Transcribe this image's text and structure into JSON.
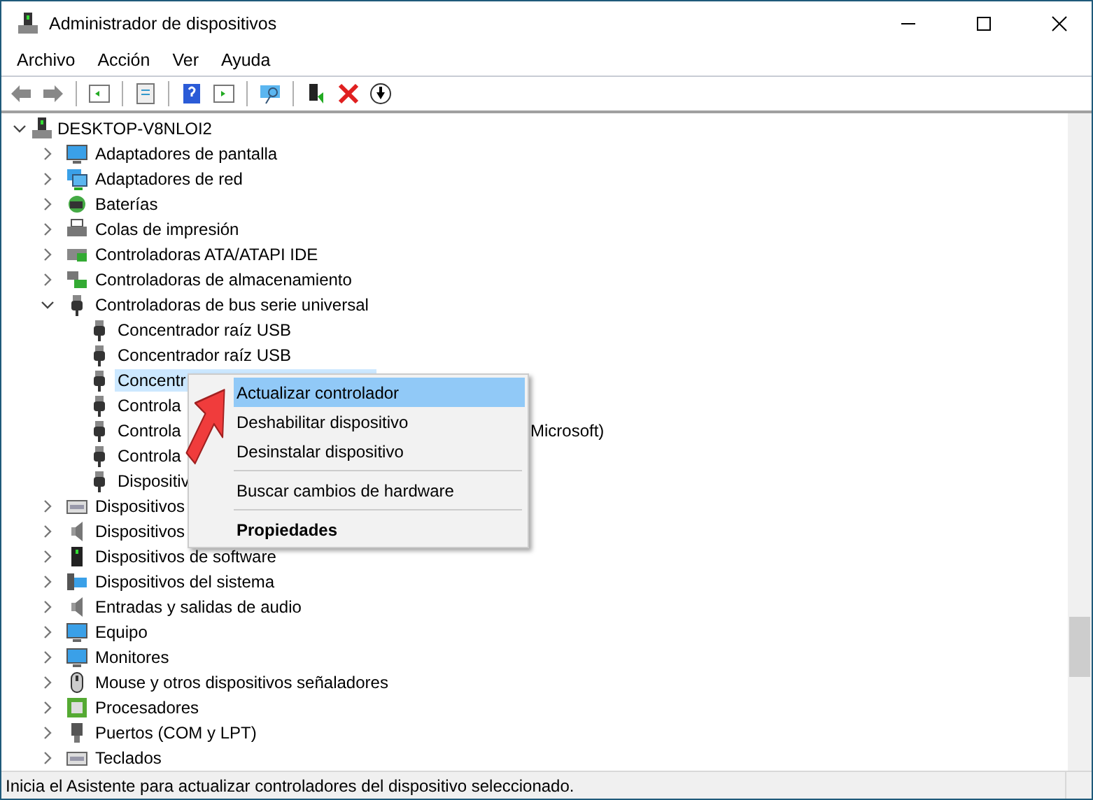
{
  "window": {
    "title": "Administrador de dispositivos"
  },
  "menu_bar": [
    "Archivo",
    "Acción",
    "Ver",
    "Ayuda"
  ],
  "tree": {
    "label": "DESKTOP-V8NLOI2",
    "expanded": true,
    "children": [
      {
        "label": "Adaptadores de pantalla",
        "expanded": false
      },
      {
        "label": "Adaptadores de red",
        "expanded": false
      },
      {
        "label": "Baterías",
        "expanded": false
      },
      {
        "label": "Colas de impresión",
        "expanded": false
      },
      {
        "label": "Controladoras ATA/ATAPI IDE",
        "expanded": false
      },
      {
        "label": "Controladoras de almacenamiento",
        "expanded": false
      },
      {
        "label": "Controladoras de bus serie universal",
        "expanded": true,
        "children": [
          {
            "label": "Concentrador raíz USB",
            "selected": false
          },
          {
            "label": "Concentrador raíz USB",
            "selected": false
          },
          {
            "label": "Concentr",
            "selected": true
          },
          {
            "label": "Controla",
            "selected": false
          },
          {
            "label": "Controla",
            "tail": "Microsoft)",
            "selected": false
          },
          {
            "label": "Controla",
            "selected": false
          },
          {
            "label": "Dispositiv",
            "selected": false
          }
        ]
      },
      {
        "label": "Dispositivos",
        "expanded": false
      },
      {
        "label": "Dispositivos",
        "expanded": false
      },
      {
        "label": "Dispositivos de software",
        "expanded": false
      },
      {
        "label": "Dispositivos del sistema",
        "expanded": false
      },
      {
        "label": "Entradas y salidas de audio",
        "expanded": false
      },
      {
        "label": "Equipo",
        "expanded": false
      },
      {
        "label": "Monitores",
        "expanded": false
      },
      {
        "label": "Mouse y otros dispositivos señaladores",
        "expanded": false
      },
      {
        "label": "Procesadores",
        "expanded": false
      },
      {
        "label": "Puertos (COM y LPT)",
        "expanded": false
      },
      {
        "label": "Teclados",
        "expanded": false
      }
    ]
  },
  "context_menu": [
    {
      "kind": "item",
      "label": "Actualizar controlador",
      "selected": true
    },
    {
      "kind": "item",
      "label": "Deshabilitar dispositivo",
      "selected": false
    },
    {
      "kind": "item",
      "label": "Desinstalar dispositivo",
      "selected": false
    },
    {
      "kind": "separator"
    },
    {
      "kind": "item",
      "label": "Buscar cambios de hardware",
      "selected": false
    },
    {
      "kind": "separator"
    },
    {
      "kind": "default",
      "label": "Propiedades",
      "selected": false
    }
  ],
  "status_bar": "Inicia el Asistente para actualizar controladores del dispositivo seleccionado."
}
